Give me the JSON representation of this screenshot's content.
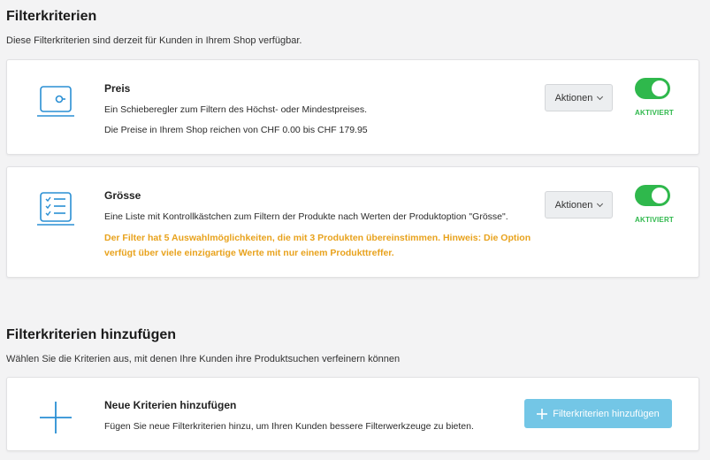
{
  "section1": {
    "title": "Filterkriterien",
    "description": "Diese Filterkriterien sind derzeit für Kunden in Ihrem Shop verfügbar."
  },
  "filters": [
    {
      "icon": "slider-icon",
      "title": "Preis",
      "lines": [
        "Ein Schieberegler zum Filtern des Höchst- oder Mindestpreises.",
        "Die Preise in Ihrem Shop reichen von CHF 0.00 bis CHF 179.95"
      ],
      "actions_label": "Aktionen",
      "toggle_on": true,
      "status": "AKTIVIERT"
    },
    {
      "icon": "checklist-icon",
      "title": "Grösse",
      "lines": [
        "Eine Liste mit Kontrollkästchen zum Filtern der Produkte nach Werten der Produktoption \"Grösse\"."
      ],
      "warning": "Der Filter hat 5 Auswahlmöglichkeiten, die mit 3 Produkten übereinstimmen. Hinweis: Die Option verfügt über viele einzigartige Werte mit nur einem Produkttreffer.",
      "actions_label": "Aktionen",
      "toggle_on": true,
      "status": "AKTIVIERT"
    }
  ],
  "section2": {
    "title": "Filterkriterien hinzufügen",
    "description": "Wählen Sie die Kriterien aus, mit denen Ihre Kunden ihre Produktsuchen verfeinern können"
  },
  "add_card": {
    "icon": "plus-icon",
    "title": "Neue Kriterien hinzufügen",
    "text": "Fügen Sie neue Filterkriterien hinzu, um Ihren Kunden bessere Filterwerkzeuge zu bieten.",
    "button_label": "Filterkriterien hinzufügen"
  },
  "colors": {
    "accent_blue": "#2a8fd4",
    "toggle_green": "#2fb84c",
    "warning_orange": "#e8a21c",
    "button_light_blue": "#73c6e6"
  }
}
